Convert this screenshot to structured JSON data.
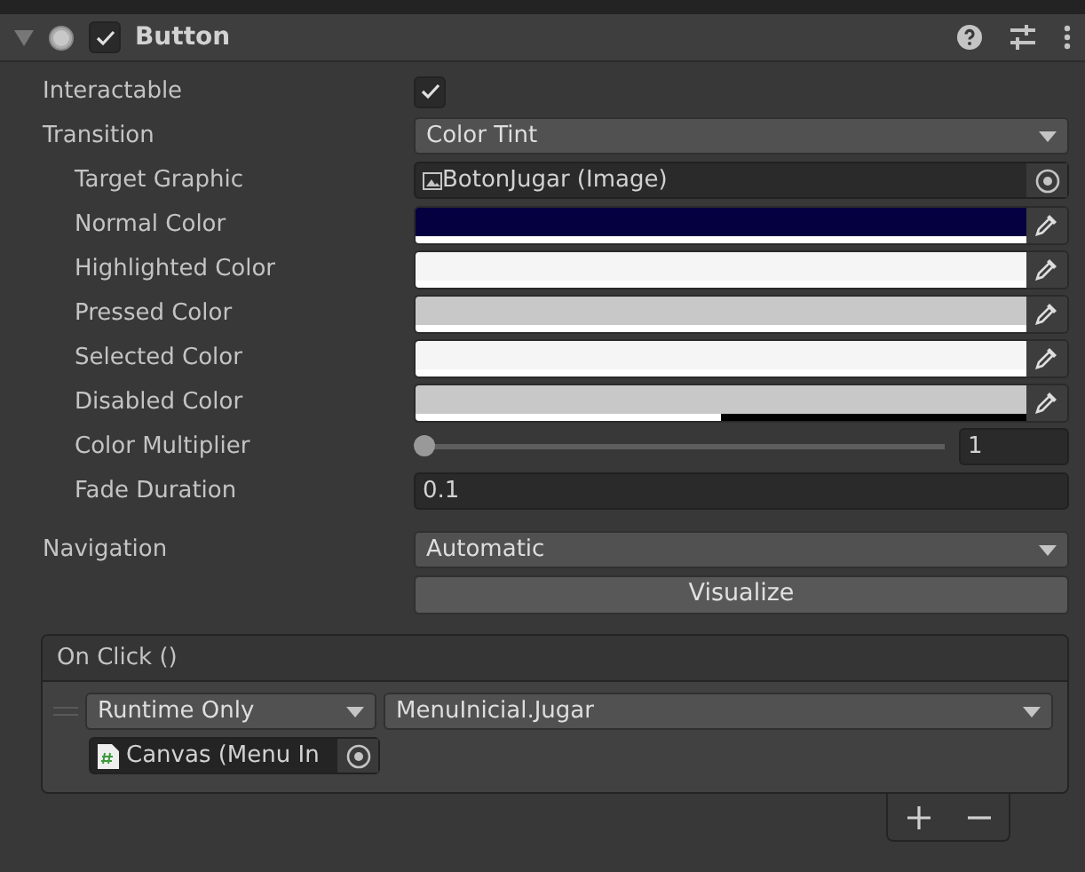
{
  "component": {
    "title": "Button",
    "expanded": true,
    "enabled": true
  },
  "properties": [
    {
      "kind": "checkbox",
      "label": "Interactable",
      "checked": true,
      "indented": false
    },
    {
      "kind": "dropdown",
      "label": "Transition",
      "value": "Color Tint",
      "indented": false
    },
    {
      "kind": "object",
      "label": "Target Graphic",
      "value": "BotonJugar (Image)",
      "indented": true
    },
    {
      "kind": "color",
      "label": "Normal Color",
      "color": "#050040",
      "level": 1,
      "indented": true
    },
    {
      "kind": "color",
      "label": "Highlighted Color",
      "color": "#f5f5f5",
      "level": 1,
      "indented": true
    },
    {
      "kind": "color",
      "label": "Pressed Color",
      "color": "#c8c8c8",
      "level": 1,
      "indented": true
    },
    {
      "kind": "color",
      "label": "Selected Color",
      "color": "#f5f5f5",
      "level": 1,
      "indented": true
    },
    {
      "kind": "color",
      "label": "Disabled Color",
      "color": "#c8c8c8",
      "level": 0.5,
      "indented": true
    },
    {
      "kind": "slider",
      "label": "Color Multiplier",
      "value": "1",
      "level": 0,
      "indented": true
    },
    {
      "kind": "text",
      "label": "Fade Duration",
      "value": "0.1",
      "indented": true
    }
  ],
  "navigation": {
    "label": "Navigation",
    "value": "Automatic"
  },
  "visualize_button": "Visualize",
  "event": {
    "title": "On Click ()",
    "mode": "Runtime Only",
    "function": "MenuInicial.Jugar",
    "target": "Canvas (Menu In"
  }
}
